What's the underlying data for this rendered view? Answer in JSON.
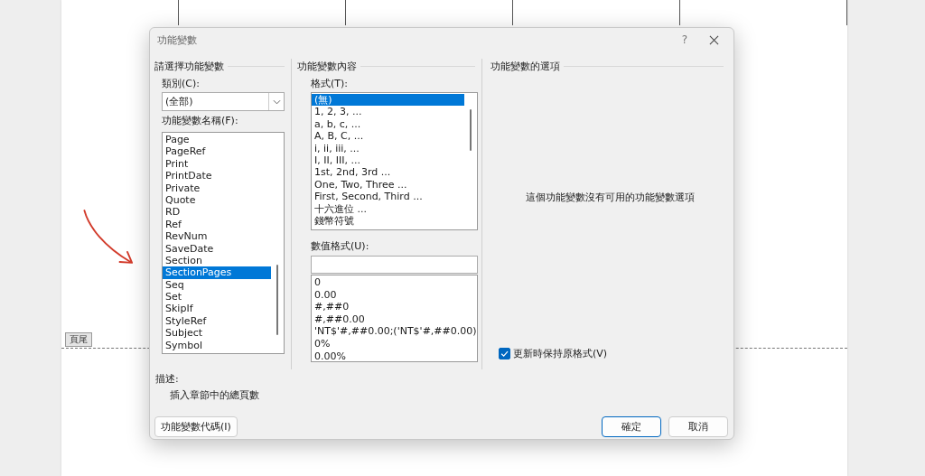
{
  "document": {
    "footer_tag": "頁尾"
  },
  "dialog": {
    "title": "功能變數",
    "help": "?",
    "choose": {
      "title": "請選擇功能變數",
      "category_label": "類別(C):",
      "category_value": "(全部)",
      "names_label": "功能變數名稱(F):",
      "names": [
        {
          "label": "Page",
          "selected": false
        },
        {
          "label": "PageRef",
          "selected": false
        },
        {
          "label": "Print",
          "selected": false
        },
        {
          "label": "PrintDate",
          "selected": false
        },
        {
          "label": "Private",
          "selected": false
        },
        {
          "label": "Quote",
          "selected": false
        },
        {
          "label": "RD",
          "selected": false
        },
        {
          "label": "Ref",
          "selected": false
        },
        {
          "label": "RevNum",
          "selected": false
        },
        {
          "label": "SaveDate",
          "selected": false
        },
        {
          "label": "Section",
          "selected": false
        },
        {
          "label": "SectionPages",
          "selected": true
        },
        {
          "label": "Seq",
          "selected": false
        },
        {
          "label": "Set",
          "selected": false
        },
        {
          "label": "SkipIf",
          "selected": false
        },
        {
          "label": "StyleRef",
          "selected": false
        },
        {
          "label": "Subject",
          "selected": false
        },
        {
          "label": "Symbol",
          "selected": false
        }
      ]
    },
    "properties": {
      "title": "功能變數內容",
      "format_label": "格式(T):",
      "formats": [
        {
          "label": "(無)",
          "selected": true
        },
        {
          "label": "1, 2, 3, ...",
          "selected": false
        },
        {
          "label": "a, b, c, ...",
          "selected": false
        },
        {
          "label": "A, B, C, ...",
          "selected": false
        },
        {
          "label": "i, ii, iii, ...",
          "selected": false
        },
        {
          "label": "I, II, III, ...",
          "selected": false
        },
        {
          "label": "1st, 2nd, 3rd ...",
          "selected": false
        },
        {
          "label": "One, Two, Three ...",
          "selected": false
        },
        {
          "label": "First, Second, Third ...",
          "selected": false
        },
        {
          "label": "十六進位 ...",
          "selected": false
        },
        {
          "label": "錢幣符號",
          "selected": false
        }
      ],
      "number_format_label": "數值格式(U):",
      "number_formats": [
        "0",
        "0.00",
        "#,##0",
        "#,##0.00",
        "'NT$'#,##0.00;('NT$'#,##0.00)",
        "0%",
        "0.00%"
      ]
    },
    "options": {
      "title": "功能變數的選項",
      "message": "這個功能變數沒有可用的功能變數選項",
      "preserve": {
        "label": "更新時保持原格式(V)",
        "checked": true
      }
    },
    "description_label": "描述:",
    "description": "插入章節中的總頁數",
    "buttons": {
      "field_codes": "功能變數代碼(I)",
      "ok": "確定",
      "cancel": "取消"
    }
  }
}
